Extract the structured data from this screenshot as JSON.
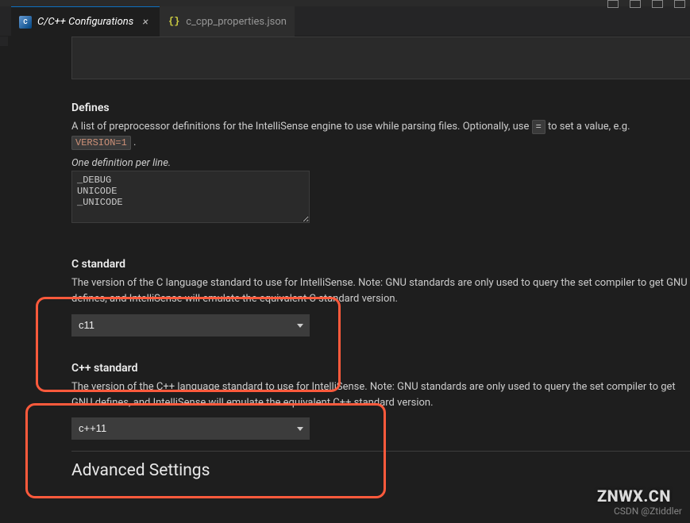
{
  "tabs": {
    "active": {
      "label": "C/C++ Configurations"
    },
    "second": {
      "label": "c_cpp_properties.json"
    }
  },
  "defines": {
    "title": "Defines",
    "desc_pre": "A list of preprocessor definitions for the IntelliSense engine to use while parsing files. Optionally, use ",
    "sym": "=",
    "desc_mid": " to set a value, e.g. ",
    "example": "VERSION=1",
    "desc_post": " .",
    "hint": "One definition per line.",
    "value": "_DEBUG\nUNICODE\n_UNICODE"
  },
  "c_standard": {
    "title": "C standard",
    "desc": "The version of the C language standard to use for IntelliSense. Note: GNU standards are only used to query the set compiler to get GNU defines, and IntelliSense will emulate the equivalent C standard version.",
    "value": "c11"
  },
  "cpp_standard": {
    "title": "C++ standard",
    "desc": "The version of the C++ language standard to use for IntelliSense. Note: GNU standards are only used to query the set compiler to get GNU defines, and IntelliSense will emulate the equivalent C++ standard version.",
    "value": "c++11"
  },
  "advanced": {
    "title": "Advanced Settings"
  },
  "watermark": "ZNWX.CN",
  "attribution": "CSDN @Ztiddler"
}
